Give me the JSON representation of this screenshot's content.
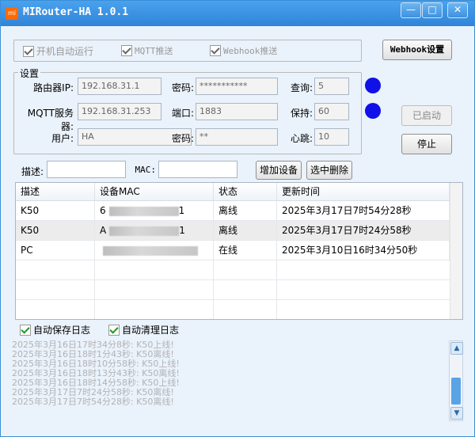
{
  "window": {
    "title": "MIRouter-HA 1.0.1",
    "icon_label": "mi",
    "min_glyph": "—",
    "max_glyph": "□",
    "close_glyph": "✕"
  },
  "options": {
    "autostart": "开机自动运行",
    "mqtt_push": "MQTT推送",
    "webhook_push": "Webhook推送",
    "webhook_settings": "Webhook设置"
  },
  "settings": {
    "legend": "设置",
    "router_ip_label": "路由器IP:",
    "router_ip": "192.168.31.1",
    "password_label": "密码:",
    "router_password": "***********",
    "query_label": "查询:",
    "query_value": "5",
    "mqtt_server_label": "MQTT服务器:",
    "mqtt_server": "192.168.31.253",
    "port_label": "端口:",
    "port": "1883",
    "keepalive_label": "保持:",
    "keepalive": "60",
    "user_label": "用户:",
    "user": "HA",
    "mqtt_password_label": "密码:",
    "mqtt_password": "**",
    "heartbeat_label": "心跳:",
    "heartbeat": "10",
    "started_button": "已启动",
    "stop_button": "停止",
    "status_color": "#1010e8"
  },
  "device_form": {
    "desc_label": "描述:",
    "desc_value": "",
    "mac_label": "MAC:",
    "mac_value": "",
    "add_button": "增加设备",
    "delete_button": "选中删除"
  },
  "table": {
    "headers": [
      "描述",
      "设备MAC",
      "状态",
      "更新时间"
    ],
    "rows": [
      {
        "desc": "K50",
        "mac_start": "6",
        "mac_end": "1",
        "status": "离线",
        "time": "2025年3月17日7时54分28秒"
      },
      {
        "desc": "K50",
        "mac_start": "A",
        "mac_end": "1",
        "status": "离线",
        "time": "2025年3月17日7时24分58秒"
      },
      {
        "desc": "PC",
        "mac_start": "",
        "mac_end": "",
        "status": "在线",
        "time": "2025年3月10日16时34分50秒"
      }
    ]
  },
  "log": {
    "auto_save": "自动保存日志",
    "auto_clean": "自动清理日志",
    "lines": [
      "2025年3月16日17时34分8秒: K50上线!",
      "2025年3月16日18时1分43秒: K50离线!",
      "2025年3月16日18时10分58秒: K50上线!",
      "2025年3月16日18时13分43秒: K50离线!",
      "2025年3月16日18时14分58秒: K50上线!",
      "2025年3月17日7时24分58秒: K50离线!",
      "2025年3月17日7时54分28秒: K50离线!"
    ]
  }
}
